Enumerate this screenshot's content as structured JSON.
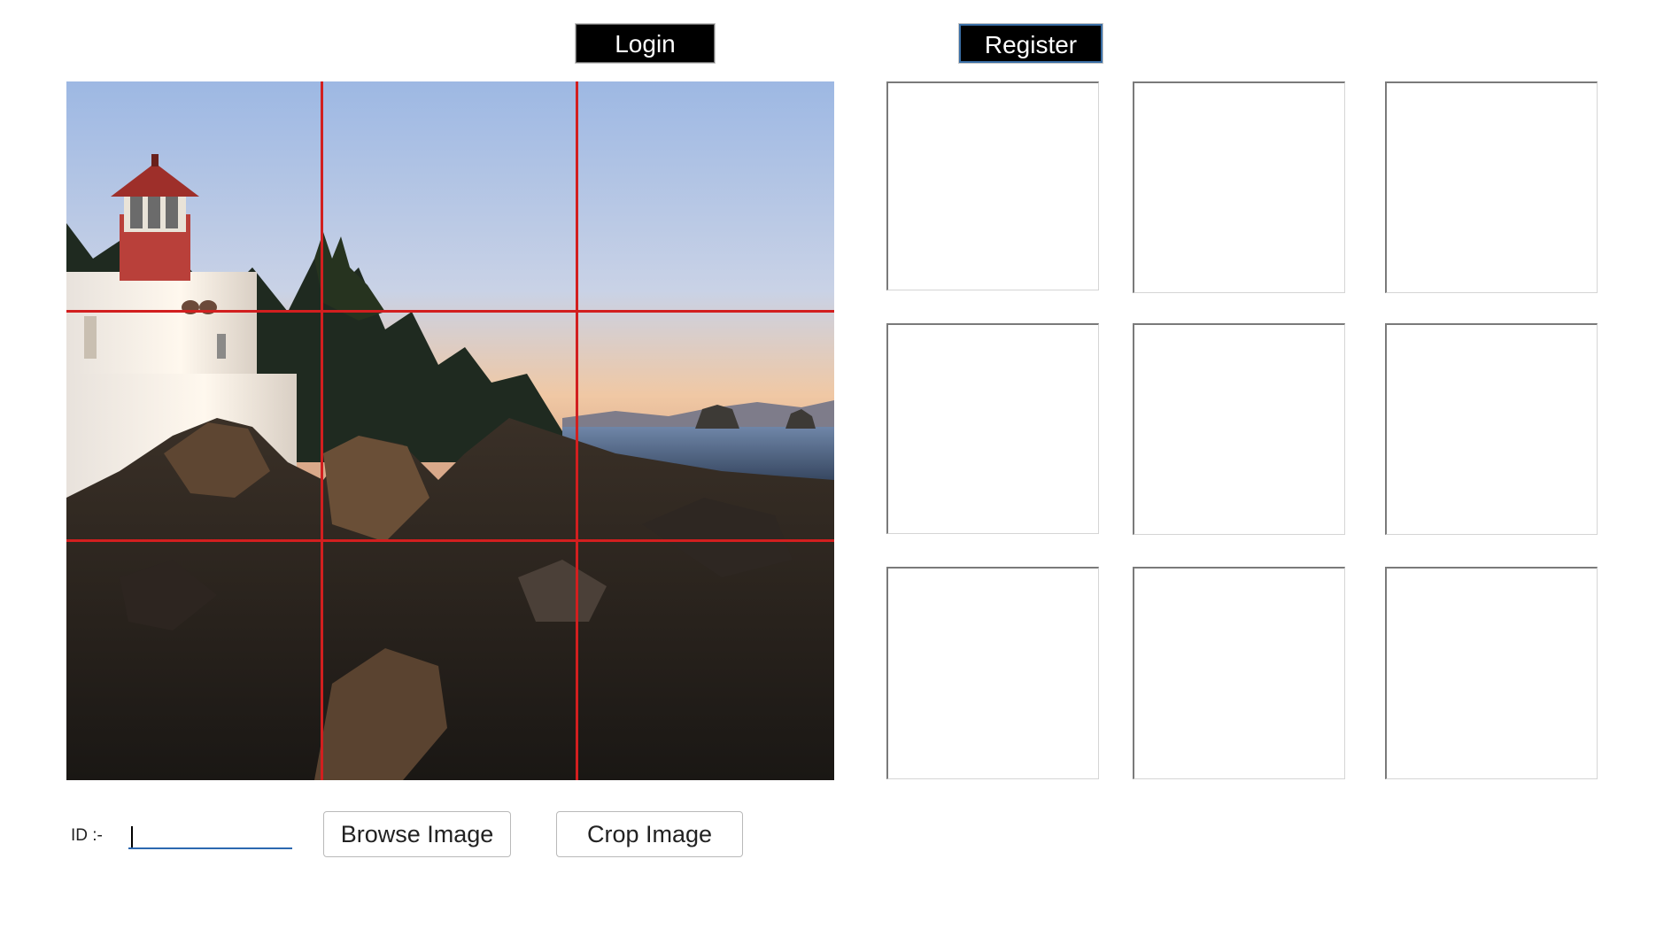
{
  "header": {
    "login_label": "Login",
    "register_label": "Register"
  },
  "crop_tiles": {
    "count": 9
  },
  "controls": {
    "id_label": "ID :-",
    "id_value": "",
    "browse_label": "Browse Image",
    "crop_label": "Crop Image"
  },
  "colors": {
    "grid_line": "#d21f1f",
    "button_dark": "#000000",
    "input_underline": "#2c68b0"
  }
}
